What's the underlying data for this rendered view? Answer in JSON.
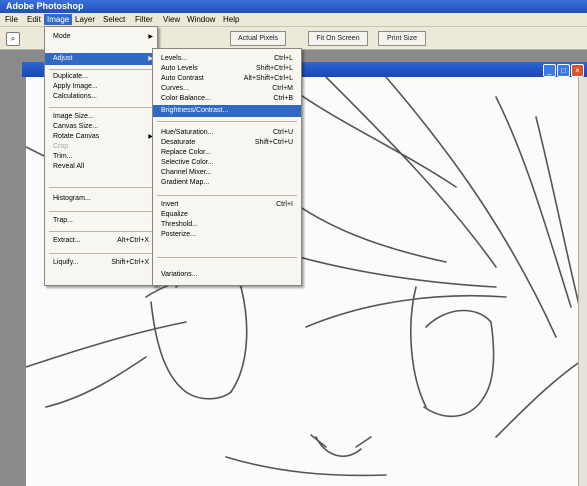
{
  "window": {
    "title": "Adobe Photoshop"
  },
  "menubar": {
    "items": [
      {
        "id": "file",
        "label": "File"
      },
      {
        "id": "edit",
        "label": "Edit"
      },
      {
        "id": "image",
        "label": "Image"
      },
      {
        "id": "layer",
        "label": "Layer"
      },
      {
        "id": "select",
        "label": "Select"
      },
      {
        "id": "filter",
        "label": "Filter"
      },
      {
        "id": "view",
        "label": "View"
      },
      {
        "id": "window",
        "label": "Window"
      },
      {
        "id": "help",
        "label": "Help"
      }
    ]
  },
  "options_bar": {
    "buttons": [
      "Actual Pixels",
      "Fit On Screen",
      "Print Size"
    ]
  },
  "image_menu": {
    "items": [
      {
        "label": "Mode",
        "submenu": true
      },
      {
        "label": "Adjust",
        "submenu": true,
        "highlight": true
      },
      {
        "sep": true
      },
      {
        "label": "Duplicate..."
      },
      {
        "label": "Apply Image..."
      },
      {
        "label": "Calculations..."
      },
      {
        "sep": true
      },
      {
        "label": "Image Size..."
      },
      {
        "label": "Canvas Size..."
      },
      {
        "label": "Rotate Canvas",
        "submenu": true
      },
      {
        "label": "Crop",
        "disabled": true
      },
      {
        "label": "Trim..."
      },
      {
        "label": "Reveal All"
      },
      {
        "sep": true
      },
      {
        "label": "Histogram..."
      },
      {
        "sep": true
      },
      {
        "label": "Trap..."
      },
      {
        "sep": true
      },
      {
        "label": "Extract...",
        "shortcut": "Alt+Ctrl+X"
      },
      {
        "sep": true
      },
      {
        "label": "Liquify...",
        "shortcut": "Shift+Ctrl+X"
      }
    ]
  },
  "adjust_submenu": {
    "items": [
      {
        "label": "Levels...",
        "shortcut": "Ctrl+L"
      },
      {
        "label": "Auto Levels",
        "shortcut": "Shift+Ctrl+L"
      },
      {
        "label": "Auto Contrast",
        "shortcut": "Alt+Shift+Ctrl+L"
      },
      {
        "label": "Curves...",
        "shortcut": "Ctrl+M"
      },
      {
        "label": "Color Balance...",
        "shortcut": "Ctrl+B"
      },
      {
        "label": "Brightness/Contrast...",
        "highlight": true
      },
      {
        "sep": true
      },
      {
        "label": "Hue/Saturation...",
        "shortcut": "Ctrl+U"
      },
      {
        "label": "Desaturate",
        "shortcut": "Shift+Ctrl+U"
      },
      {
        "label": "Replace Color..."
      },
      {
        "label": "Selective Color..."
      },
      {
        "label": "Channel Mixer..."
      },
      {
        "label": "Gradient Map..."
      },
      {
        "sep": true
      },
      {
        "label": "Invert",
        "shortcut": "Ctrl+I"
      },
      {
        "label": "Equalize"
      },
      {
        "label": "Threshold..."
      },
      {
        "label": "Posterize..."
      },
      {
        "sep": true
      },
      {
        "label": "Variations..."
      }
    ]
  },
  "colors": {
    "highlight": "#316ac5",
    "titlebar": "#1f4fb8",
    "menu_bg": "#f7f6f1"
  }
}
